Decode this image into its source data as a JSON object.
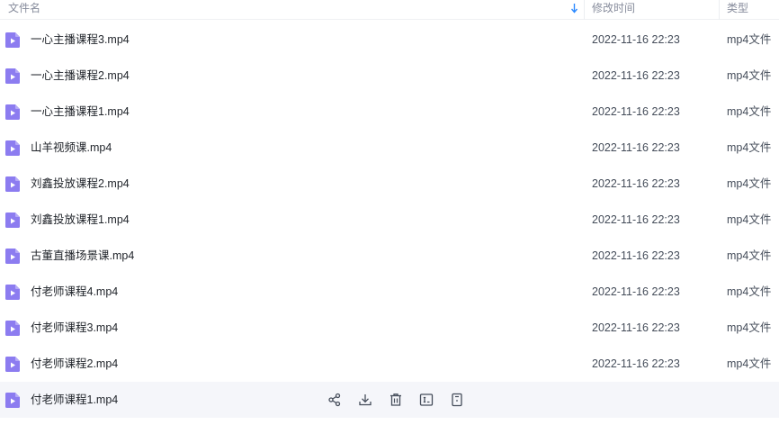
{
  "header": {
    "col_name": "文件名",
    "col_time": "修改时间",
    "col_type": "类型",
    "sort_icon": "arrow-down-icon",
    "sort_color": "#2e8bff"
  },
  "file_icon": {
    "name": "video-file-icon",
    "color": "#8c7cf0"
  },
  "files": [
    {
      "name": "一心主播课程3.mp4",
      "time": "2022-11-16 22:23",
      "type": "mp4文件"
    },
    {
      "name": "一心主播课程2.mp4",
      "time": "2022-11-16 22:23",
      "type": "mp4文件"
    },
    {
      "name": "一心主播课程1.mp4",
      "time": "2022-11-16 22:23",
      "type": "mp4文件"
    },
    {
      "name": "山羊视频课.mp4",
      "time": "2022-11-16 22:23",
      "type": "mp4文件"
    },
    {
      "name": "刘鑫投放课程2.mp4",
      "time": "2022-11-16 22:23",
      "type": "mp4文件"
    },
    {
      "name": "刘鑫投放课程1.mp4",
      "time": "2022-11-16 22:23",
      "type": "mp4文件"
    },
    {
      "name": "古董直播场景课.mp4",
      "time": "2022-11-16 22:23",
      "type": "mp4文件"
    },
    {
      "name": "付老师课程4.mp4",
      "time": "2022-11-16 22:23",
      "type": "mp4文件"
    },
    {
      "name": "付老师课程3.mp4",
      "time": "2022-11-16 22:23",
      "type": "mp4文件"
    },
    {
      "name": "付老师课程2.mp4",
      "time": "2022-11-16 22:23",
      "type": "mp4文件"
    },
    {
      "name": "付老师课程1.mp4",
      "time": "",
      "type": ""
    }
  ],
  "hover_actions": [
    "share-icon",
    "download-icon",
    "delete-icon",
    "rename-icon",
    "more-icon"
  ]
}
